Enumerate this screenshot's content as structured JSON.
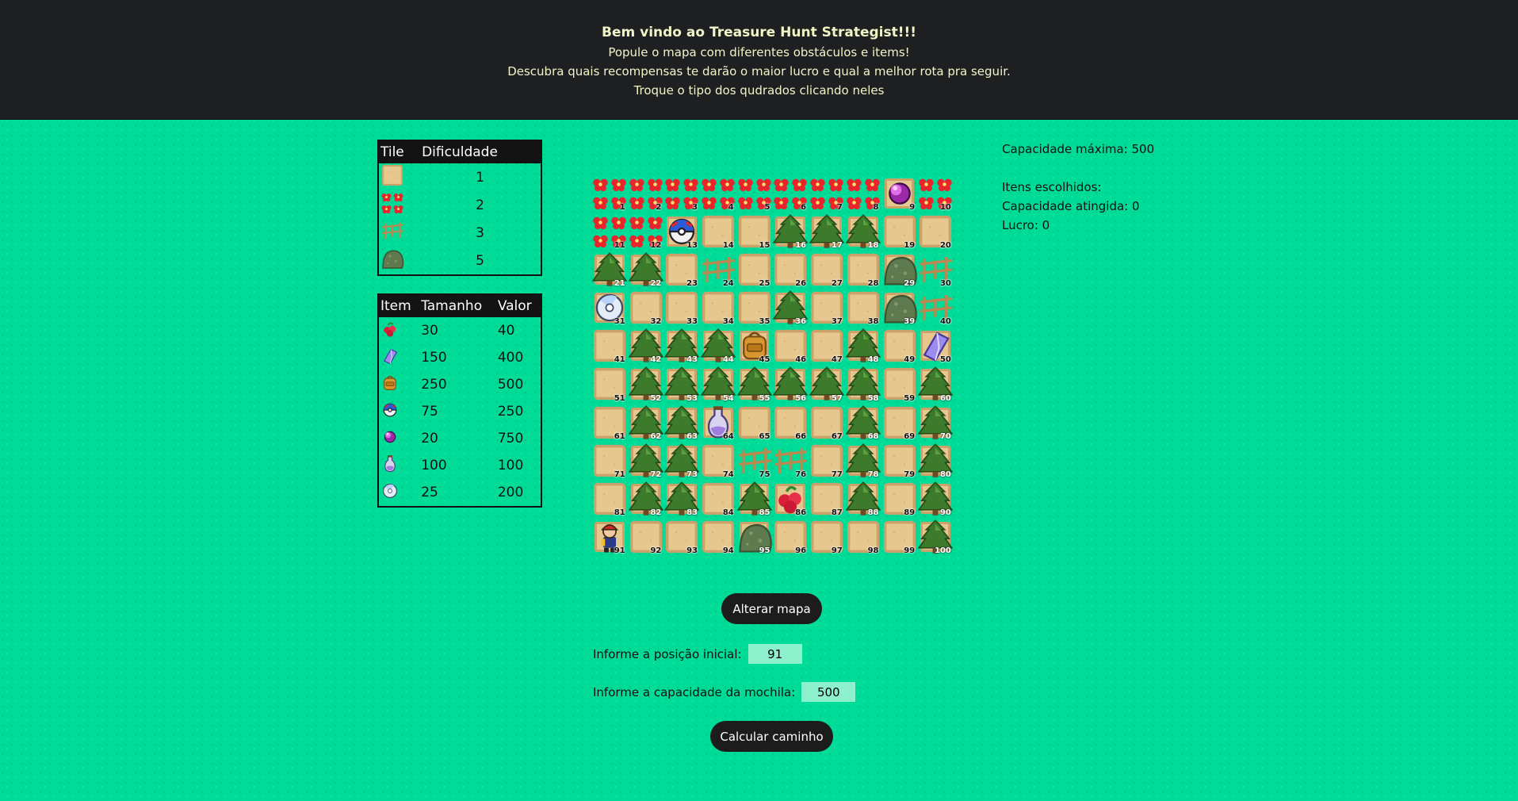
{
  "header": {
    "title": "Bem vindo ao Treasure Hunt Strategist!!!",
    "line1": "Popule o mapa com diferentes obstáculos e items!",
    "line2": "Descubra quais recompensas te darão o maior lucro e qual a melhor rota pra seguir.",
    "line3": "Troque o tipo dos qudrados clicando neles"
  },
  "tile_table": {
    "headers": [
      "Tile",
      "Dificuldade"
    ],
    "rows": [
      {
        "icon": "sand-tile-icon",
        "difficulty": "1"
      },
      {
        "icon": "flowers-tile-icon",
        "difficulty": "2"
      },
      {
        "icon": "fence-tile-icon",
        "difficulty": "3"
      },
      {
        "icon": "rock-tile-icon",
        "difficulty": "5"
      }
    ]
  },
  "item_table": {
    "headers": [
      "Item",
      "Tamanho",
      "Valor"
    ],
    "rows": [
      {
        "icon": "berry-icon",
        "size": "30",
        "value": "40"
      },
      {
        "icon": "crystal-icon",
        "size": "150",
        "value": "400"
      },
      {
        "icon": "backpack-icon",
        "size": "250",
        "value": "500"
      },
      {
        "icon": "pokeball-icon",
        "size": "75",
        "value": "250"
      },
      {
        "icon": "orb-icon",
        "size": "20",
        "value": "750"
      },
      {
        "icon": "potion-icon",
        "size": "100",
        "value": "100"
      },
      {
        "icon": "disc-icon",
        "size": "25",
        "value": "200"
      }
    ]
  },
  "map": {
    "cells": [
      "flowers",
      "flowers",
      "flowers",
      "flowers",
      "flowers",
      "flowers",
      "flowers",
      "flowers",
      "orb",
      "flowers",
      "flowers",
      "flowers",
      "pokeball",
      "sand",
      "sand",
      "tree",
      "tree",
      "tree",
      "sand",
      "sand",
      "tree",
      "tree",
      "sand",
      "fence",
      "sand",
      "sand",
      "sand",
      "sand",
      "rock",
      "fence",
      "disc",
      "sand",
      "sand",
      "sand",
      "sand",
      "tree",
      "sand",
      "sand",
      "rock",
      "fence",
      "sand",
      "tree",
      "tree",
      "tree",
      "backpack",
      "sand",
      "sand",
      "tree",
      "sand",
      "crystal",
      "sand",
      "tree",
      "tree",
      "tree",
      "tree",
      "tree",
      "tree",
      "tree",
      "sand",
      "tree",
      "sand",
      "tree",
      "tree",
      "potion",
      "sand",
      "sand",
      "sand",
      "tree",
      "sand",
      "tree",
      "sand",
      "tree",
      "tree",
      "sand",
      "fence",
      "fence",
      "sand",
      "tree",
      "sand",
      "tree",
      "sand",
      "tree",
      "tree",
      "sand",
      "tree",
      "berry",
      "sand",
      "tree",
      "sand",
      "tree",
      "player",
      "sand",
      "sand",
      "sand",
      "rock",
      "sand",
      "sand",
      "sand",
      "sand",
      "tree"
    ]
  },
  "info": {
    "capacity_max": "Capacidade máxima: 500",
    "items_chosen": "Itens escolhidos:",
    "capacity_reached": "Capacidade atingida: 0",
    "profit": "Lucro: 0"
  },
  "buttons": {
    "alterar": "Alterar mapa",
    "calcular": "Calcular caminho"
  },
  "form": {
    "pos_label": "Informe a posição inicial:",
    "pos_value": "91",
    "cap_label": "Informe a capacidade da mochila:",
    "cap_value": "500"
  }
}
